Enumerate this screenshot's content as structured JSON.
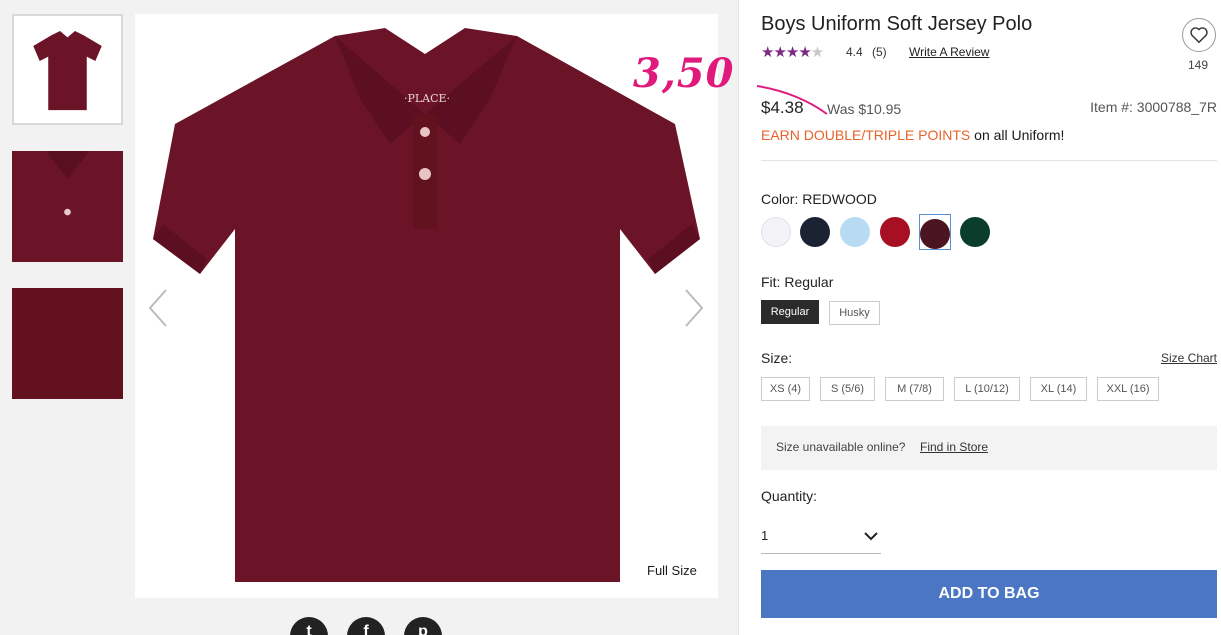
{
  "product": {
    "title": "Boys Uniform Soft Jersey Polo",
    "rating": "4.4",
    "review_count": "(5)",
    "write_review": "Write A Review",
    "favorites": "149",
    "price": "$4.38",
    "was_price": "Was $10.95",
    "item_number": "Item #: 3000788_7R",
    "earn_highlight": "EARN DOUBLE/TRIPLE POINTS",
    "earn_rest": " on all Uniform!",
    "handwritten_note": "3,50",
    "stars_filled": 4.4
  },
  "gallery": {
    "full_size": "Full Size"
  },
  "color": {
    "label": "Color: REDWOOD",
    "swatches": [
      "#f4f4f8",
      "#1a2233",
      "#b8dbf4",
      "#a80f22",
      "#4a1420",
      "#0a3d2c"
    ]
  },
  "fit": {
    "label": "Fit: Regular",
    "options": [
      "Regular",
      "Husky"
    ]
  },
  "size": {
    "label": "Size:",
    "chart_link": "Size Chart",
    "options": [
      "XS (4)",
      "S (5/6)",
      "M (7/8)",
      "L (10/12)",
      "XL (14)",
      "XXL (16)"
    ]
  },
  "store": {
    "unavailable": "Size unavailable online?",
    "find": "Find in Store"
  },
  "quantity": {
    "label": "Quantity:",
    "value": "1"
  },
  "cta": {
    "add_to_bag": "ADD TO BAG"
  },
  "colors": {
    "shirt": "#6b1427",
    "accent_button": "#4a76c4",
    "earn": "#e8632b",
    "stars": "#7c2a84",
    "note": "#e0197d"
  }
}
